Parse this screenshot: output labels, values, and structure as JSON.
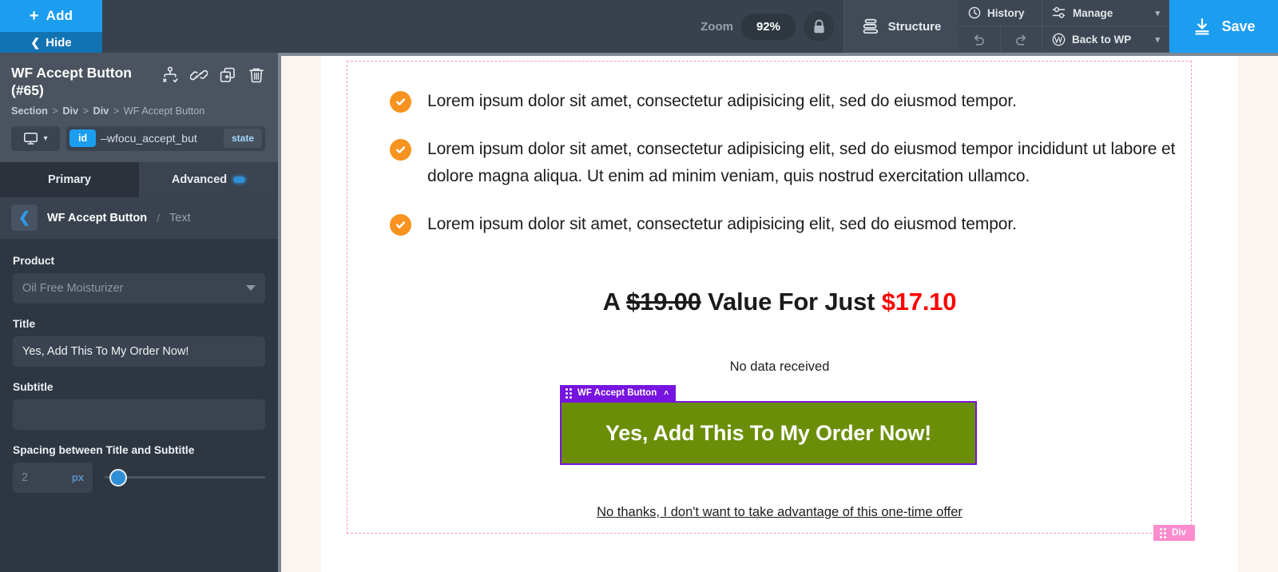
{
  "topbar": {
    "add_label": "Add",
    "hide_label": "Hide",
    "zoom_label": "Zoom",
    "zoom_value": "92%",
    "lock_icon": "lock-icon",
    "structure_label": "Structure",
    "history_label": "History",
    "manage_label": "Manage",
    "back_to_wp_label": "Back to WP",
    "save_label": "Save",
    "accent_blue": "#1b9df0"
  },
  "sidebar": {
    "title": "WF Accept Button (#65)",
    "header_icons": [
      "conditions-icon",
      "link-icon",
      "duplicate-icon",
      "trash-icon"
    ],
    "breadcrumb": {
      "items": [
        "Section",
        "Div",
        "Div"
      ],
      "current": "WF Accept Button",
      "separator": ">"
    },
    "device": "desktop",
    "id_tag": "id",
    "id_value": "–wfocu_accept_but",
    "state_tag": "state",
    "tabs": [
      {
        "label": "Primary",
        "active": true
      },
      {
        "label": "Advanced",
        "active": false,
        "badge": "minus"
      }
    ],
    "subnav": {
      "back_icon": "chevron-left-icon",
      "current": "WF Accept Button",
      "separator": "/",
      "next": "Text"
    },
    "fields": {
      "product_label": "Product",
      "product_value": "Oil Free Moisturizer",
      "title_label": "Title",
      "title_value": "Yes, Add This To My Order Now!",
      "subtitle_label": "Subtitle",
      "subtitle_value": "",
      "spacing_label": "Spacing between Title and Subtitle",
      "spacing_value": "2",
      "spacing_unit": "px"
    }
  },
  "canvas": {
    "bullets": [
      "Lorem ipsum dolor sit amet, consectetur adipisicing elit, sed do eiusmod tempor.",
      "Lorem ipsum dolor sit amet, consectetur adipisicing elit, sed do eiusmod tempor incididunt ut labore et dolore magna aliqua. Ut enim ad minim veniam, quis nostrud exercitation ullamco.",
      "Lorem ipsum dolor sit amet, consectetur adipisicing elit, sed do eiusmod tempor."
    ],
    "bullet_icon": "check-circle-icon",
    "price": {
      "prefix": "A",
      "old": "$19.00",
      "middle": "Value For Just",
      "new": "$17.10",
      "new_color": "#fe0000"
    },
    "no_data": "No data received",
    "accept_button": {
      "label": "Yes, Add This To My Order Now!",
      "background": "#6b8e08",
      "outline": "#7714e0"
    },
    "element_badge": {
      "label": "WF Accept Button",
      "color": "#7714e0",
      "chevron": "˄"
    },
    "decline_link": "No thanks, I don't want to take advantage of this one-time offer",
    "div_badge": {
      "label": "Div",
      "color": "#fc8ccd"
    }
  }
}
